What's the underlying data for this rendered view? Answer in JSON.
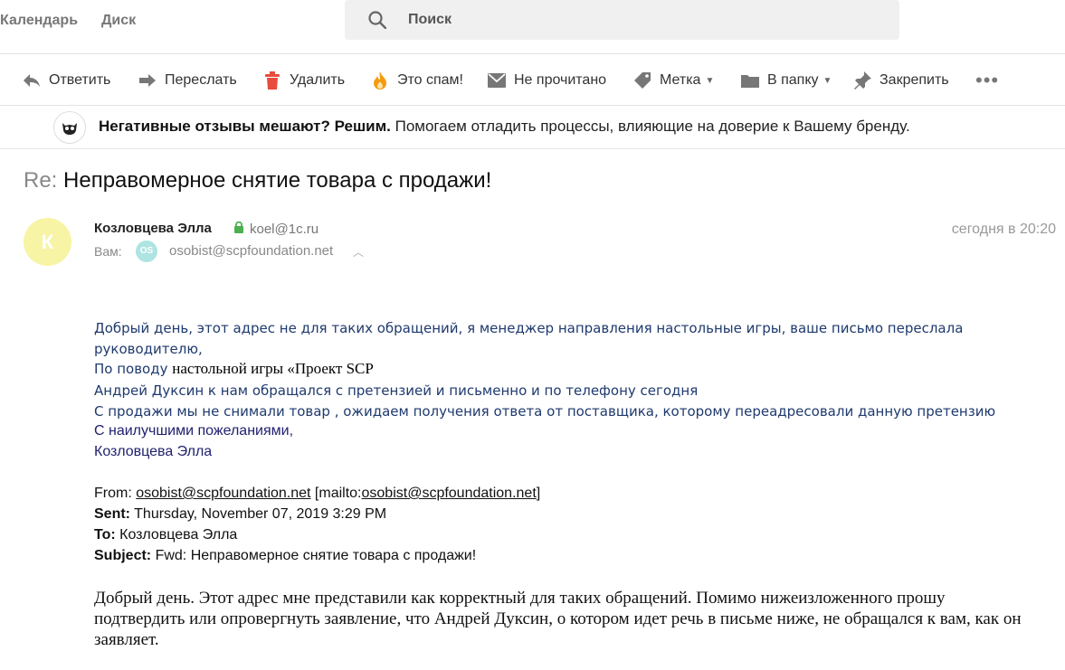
{
  "top_nav": {
    "calendar": "Календарь",
    "disk": "Диск"
  },
  "search": {
    "placeholder": "Поиск"
  },
  "toolbar": {
    "reply": "Ответить",
    "forward": "Переслать",
    "delete": "Удалить",
    "spam": "Это спам!",
    "unread": "Не прочитано",
    "label": "Метка",
    "folder": "В папку",
    "pin": "Закрепить"
  },
  "ad": {
    "bold": "Негативные отзывы мешают? Решим.",
    "text": " Помогаем отладить процессы, влияющие на доверие к Вашему бренду."
  },
  "message": {
    "subject_prefix": "Re:",
    "subject": " Неправомерное снятие товара с продажи!",
    "avatar_letter": "К",
    "sender_name": "Козловцева Элла",
    "sender_email": "koel@1c.ru",
    "date": "сегодня в 20:20",
    "to_label": "Вам:",
    "to_initials": "OS",
    "to_email": "osobist@scpfoundation.net"
  },
  "body": {
    "line1": "Добрый день, этот адрес не для таких обращений, я менеджер направления настольные игры, ваше письмо переслала",
    "line2": "руководителю,",
    "line3_prefix": "По поводу ",
    "line3_serif": "настольной игры «Проект SCP",
    "line4": "Андрей Дуксин к нам обращался с претензией и письменно и по телефону сегодня",
    "line5": "С продажи мы не снимали товар , ожидаем  получения ответа от поставщика, которому переадресовали  данную претензию",
    "sig1": "С наилучшими пожеланиями,",
    "sig2": "Козловцева Элла"
  },
  "forwarded": {
    "from_label": "From: ",
    "from_email": "osobist@scpfoundation.net",
    "mailto_open": " [mailto:",
    "mailto_email": "osobist@scpfoundation.net",
    "mailto_close": "]",
    "sent_label": "Sent:",
    "sent_value": " Thursday, November 07, 2019 3:29 PM",
    "to_label": "To:",
    "to_value": " Козловцева Элла",
    "subject_label": "Subject:",
    "subject_value": " Fwd: Неправомерное снятие товара с продажи!",
    "paragraph": "Добрый день. Этот адрес мне представили как корректный для таких обращений. Помимо нижеизложенного прошу подтвердить или опровергнуть заявление, что Андрей Дуксин, о котором идет речь в письме ниже, не обращался к вам, как он заявляет."
  },
  "icons": {
    "reply": "reply-arrow-icon",
    "forward": "forward-arrow-icon",
    "delete": "trash-icon",
    "spam": "flame-icon",
    "unread": "envelope-icon",
    "label": "tag-icon",
    "folder": "folder-icon",
    "pin": "pin-icon",
    "more": "more-dots-icon",
    "search": "search-icon",
    "lock": "lock-icon",
    "owl": "owl-logo-icon"
  },
  "colors": {
    "spam_flame": "#f39c12",
    "trash": "#e74c3c",
    "lock": "#4caf50",
    "avatar_bg": "#f7f4a6",
    "body_blue": "#1f3a6e"
  }
}
